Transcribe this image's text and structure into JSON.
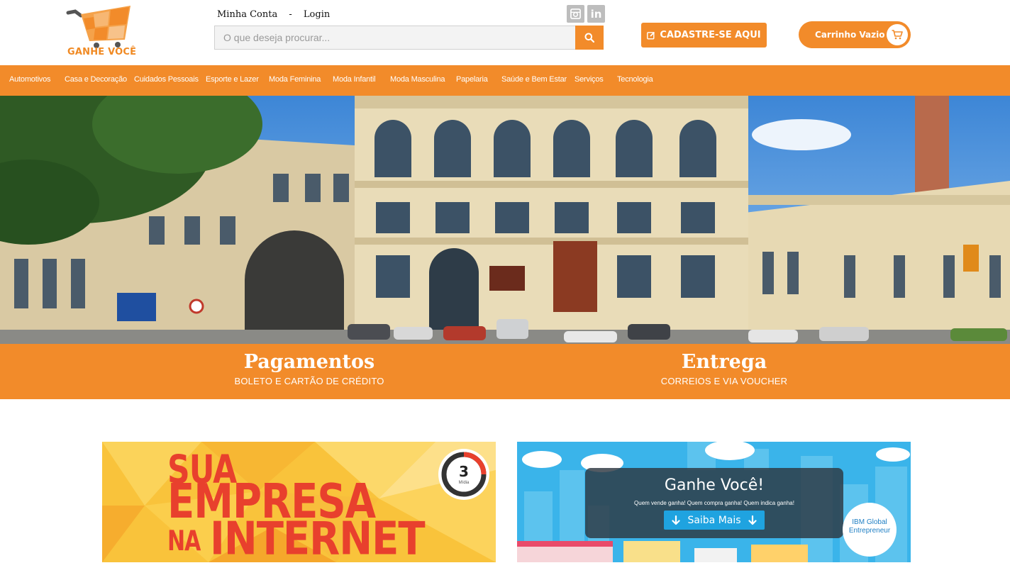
{
  "brand": {
    "name": "GANHE VOCÊ",
    "accent_color": "#f28b2a"
  },
  "header": {
    "my_account": "Minha Conta",
    "separator": "-",
    "login": "Login",
    "social_icons": [
      "instagram-icon",
      "linkedin-icon"
    ],
    "search": {
      "placeholder": "O que deseja procurar...",
      "value": "",
      "button_icon": "search-icon"
    },
    "register_button": "CADASTRE-SE AQUI",
    "register_icon": "edit-icon",
    "cart_label": "Carrinho Vazio",
    "cart_icon": "cart-icon"
  },
  "nav": {
    "items": [
      "Automotivos",
      "Casa e Decoração",
      "Cuidados Pessoais",
      "Esporte e Lazer",
      "Moda Feminina",
      "Moda Infantil",
      "Moda Masculina",
      "Papelaria",
      "Saúde e Bem Estar",
      "Serviços",
      "Tecnologia"
    ]
  },
  "hero": {
    "description_icon": "hero-building-image"
  },
  "info_band": {
    "payments": {
      "title": "Pagamentos",
      "subtitle": "BOLETO E CARTÃO DE CRÉDITO"
    },
    "delivery": {
      "title": "Entrega",
      "subtitle": "CORREIOS E VIA VOUCHER"
    }
  },
  "promos": {
    "left": {
      "line1": "SUA",
      "line2": "EMPRESA",
      "line3a": "NA",
      "line3b": "INTERNET",
      "badge_number": "3",
      "badge_sub": "Mídia"
    },
    "right": {
      "title": "Ganhe Você!",
      "subtitle": "Quem vende ganha! Quem compra ganha! Quem indica ganha!",
      "button": "Saiba Mais",
      "badge_line1": "IBM Global",
      "badge_line2": "Entrepreneur"
    }
  }
}
